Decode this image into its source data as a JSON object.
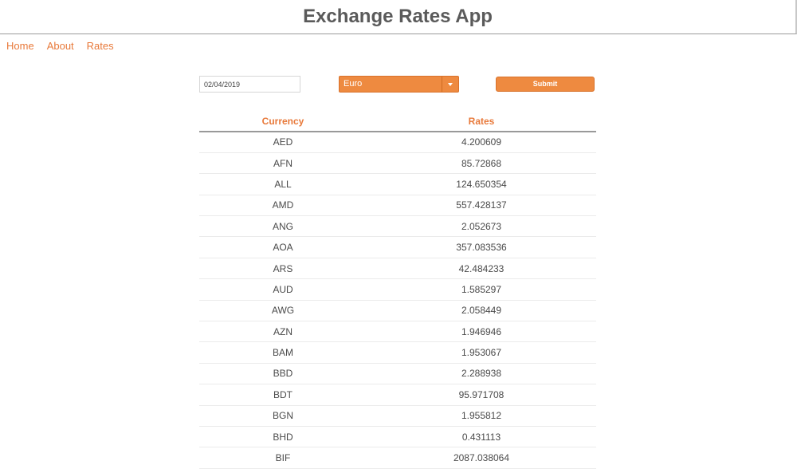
{
  "header": {
    "title": "Exchange Rates App"
  },
  "nav": {
    "items": [
      {
        "label": "Home"
      },
      {
        "label": "About"
      },
      {
        "label": "Rates"
      }
    ]
  },
  "form": {
    "date_value": "02/04/2019",
    "currency_selected": "Euro",
    "submit_label": "Submit"
  },
  "table": {
    "headers": [
      "Currency",
      "Rates"
    ],
    "rows": [
      {
        "currency": "AED",
        "rate": "4.200609"
      },
      {
        "currency": "AFN",
        "rate": "85.72868"
      },
      {
        "currency": "ALL",
        "rate": "124.650354"
      },
      {
        "currency": "AMD",
        "rate": "557.428137"
      },
      {
        "currency": "ANG",
        "rate": "2.052673"
      },
      {
        "currency": "AOA",
        "rate": "357.083536"
      },
      {
        "currency": "ARS",
        "rate": "42.484233"
      },
      {
        "currency": "AUD",
        "rate": "1.585297"
      },
      {
        "currency": "AWG",
        "rate": "2.058449"
      },
      {
        "currency": "AZN",
        "rate": "1.946946"
      },
      {
        "currency": "BAM",
        "rate": "1.953067"
      },
      {
        "currency": "BBD",
        "rate": "2.288938"
      },
      {
        "currency": "BDT",
        "rate": "95.971708"
      },
      {
        "currency": "BGN",
        "rate": "1.955812"
      },
      {
        "currency": "BHD",
        "rate": "0.431113"
      },
      {
        "currency": "BIF",
        "rate": "2087.038064"
      }
    ]
  },
  "colors": {
    "accent": "#ee8a40",
    "link": "#e8793a",
    "title": "#5a5a5a"
  }
}
